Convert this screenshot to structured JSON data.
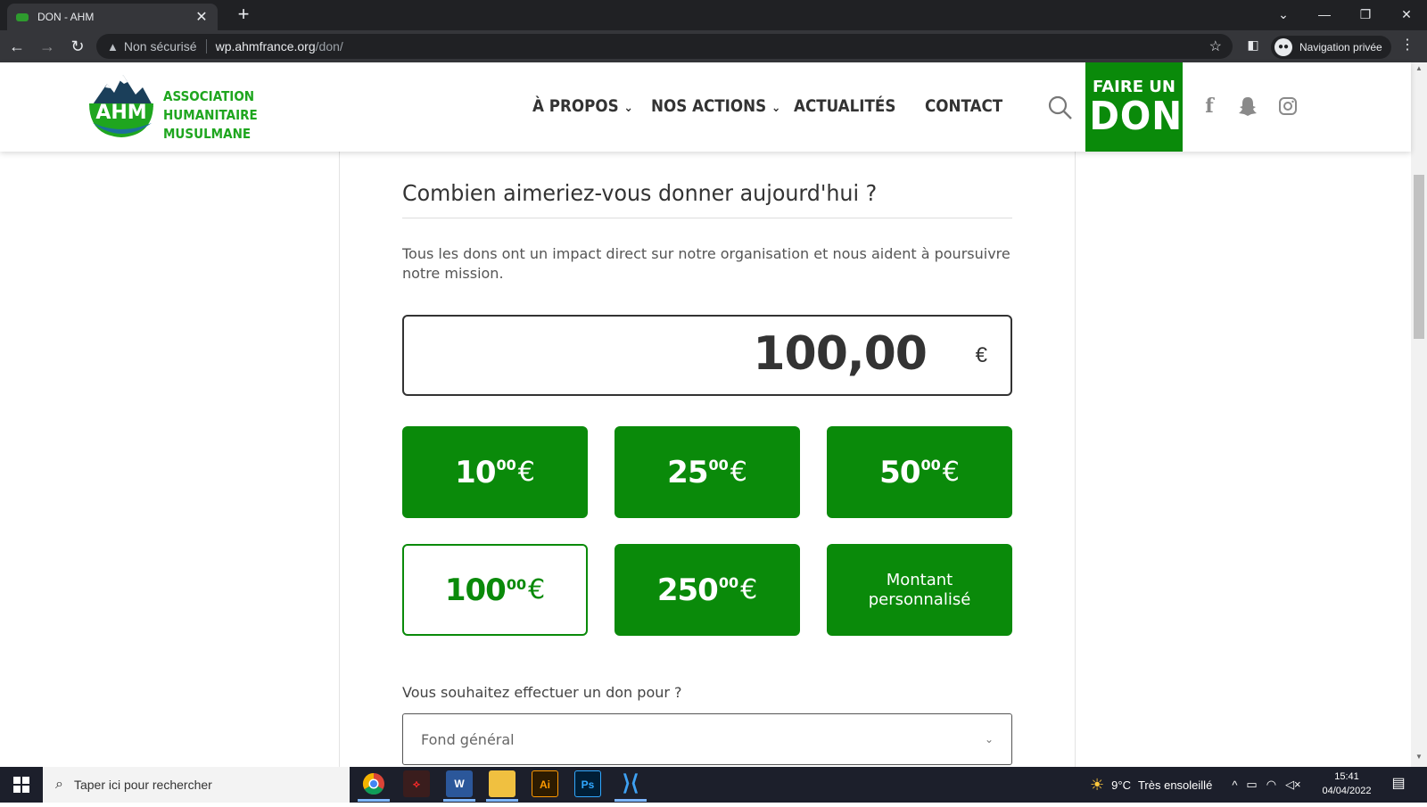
{
  "browser": {
    "tab_title": "DON - AHM",
    "security_label": "Non sécurisé",
    "url_host": "wp.ahmfrance.org",
    "url_path": "/don/",
    "private_label": "Navigation privée"
  },
  "site": {
    "logo_initials": "AHM",
    "logo_line1": "ASSOCIATION",
    "logo_line2": "HUMANITAIRE",
    "logo_line3": "MUSULMANE",
    "nav": {
      "about": "À PROPOS",
      "actions": "NOS ACTIONS",
      "news": "ACTUALITÉS",
      "contact": "CONTACT"
    },
    "donate_line1": "FAIRE UN",
    "donate_line2": "DON",
    "brand_color": "#0a8a0a"
  },
  "donation": {
    "heading": "Combien aimeriez-vous donner aujourd'hui ?",
    "description": "Tous les dons ont un impact direct sur notre organisation et nous aident à poursuivre notre mission.",
    "amount_value": "100,00",
    "currency": "€",
    "presets": [
      {
        "whole": "10",
        "cents": "00",
        "currency": "€"
      },
      {
        "whole": "25",
        "cents": "00",
        "currency": "€"
      },
      {
        "whole": "50",
        "cents": "00",
        "currency": "€"
      },
      {
        "whole": "100",
        "cents": "00",
        "currency": "€"
      },
      {
        "whole": "250",
        "cents": "00",
        "currency": "€"
      }
    ],
    "selected_preset": "100",
    "custom_line1": "Montant",
    "custom_line2": "personnalisé",
    "purpose_label": "Vous souhaitez effectuer un don pour ?",
    "purpose_value": "Fond général"
  },
  "taskbar": {
    "search_placeholder": "Taper ici pour rechercher",
    "weather_temp": "9°C",
    "weather_text": "Très ensoleillé",
    "time": "15:41",
    "date": "04/04/2022",
    "apps": [
      "chrome-icon",
      "acrobat-icon",
      "word-icon",
      "file-explorer-icon",
      "illustrator-icon",
      "photoshop-icon",
      "vscode-icon"
    ],
    "word_glyph": "W",
    "illustrator_glyph": "Ai",
    "photoshop_glyph": "Ps"
  }
}
